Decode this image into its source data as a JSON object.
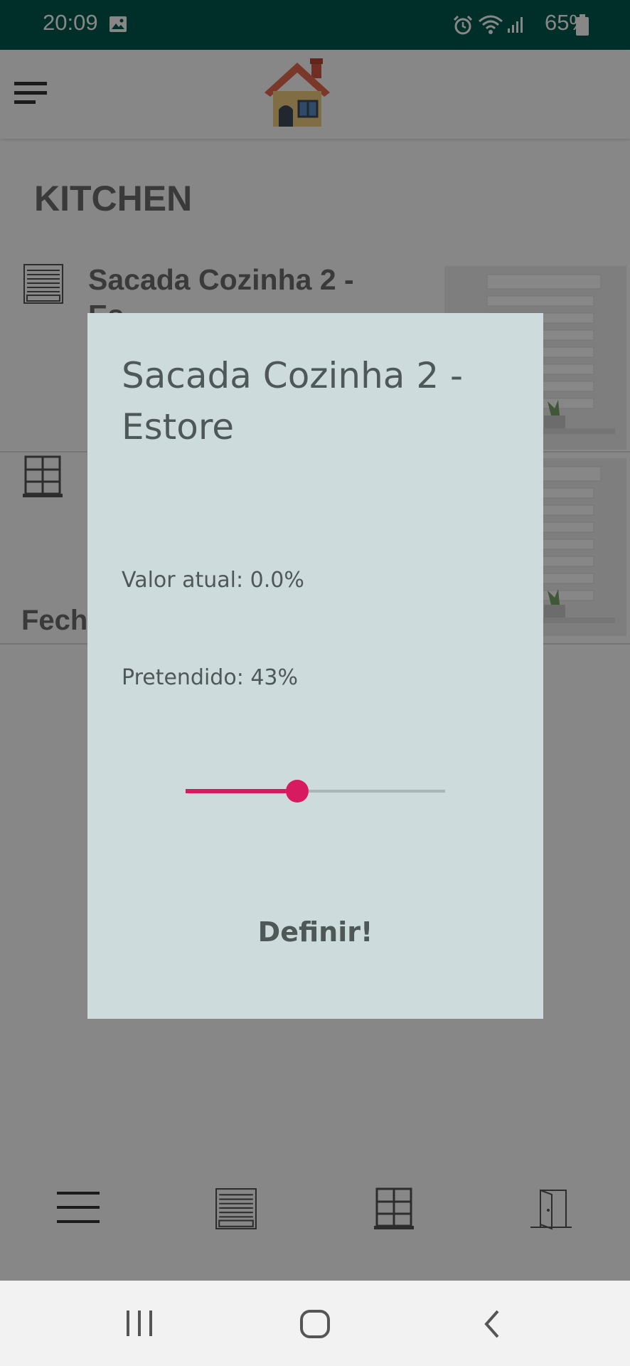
{
  "status_bar": {
    "time": "20:09",
    "battery": "65%",
    "icons": [
      "image-icon",
      "alarm-icon",
      "wifi-icon",
      "signal-icon",
      "battery-icon"
    ]
  },
  "app_bar": {
    "icons": [
      "menu-icon",
      "house-logo"
    ]
  },
  "background_screen": {
    "section_title": "KITCHEN",
    "items": [
      {
        "name": "Sacada Cozinha 2 -",
        "name_continued": "Es",
        "icon": "blind-icon"
      },
      {
        "name": "",
        "icon": "window-icon"
      }
    ],
    "partial_text": "Fech"
  },
  "dialog": {
    "title": "Sacada Cozinha 2 - Estore",
    "current_value": "Valor atual: 0.0%",
    "target_value": "Pretendido: 43%",
    "slider_value": 43,
    "slider_fraction": 0.43,
    "button_label": "Definir!"
  },
  "bottom_nav": {
    "items": [
      "menu-icon",
      "blind-icon",
      "window-icon",
      "door-icon"
    ]
  },
  "system_nav": {
    "items": [
      "recent-apps-icon",
      "home-icon",
      "back-icon"
    ]
  },
  "colors": {
    "status_bar": "#00584c",
    "dialog_bg": "#cddbdc",
    "slider_accent": "#d81b60",
    "dim_overlay": "rgba(0,0,0,0.47)"
  }
}
